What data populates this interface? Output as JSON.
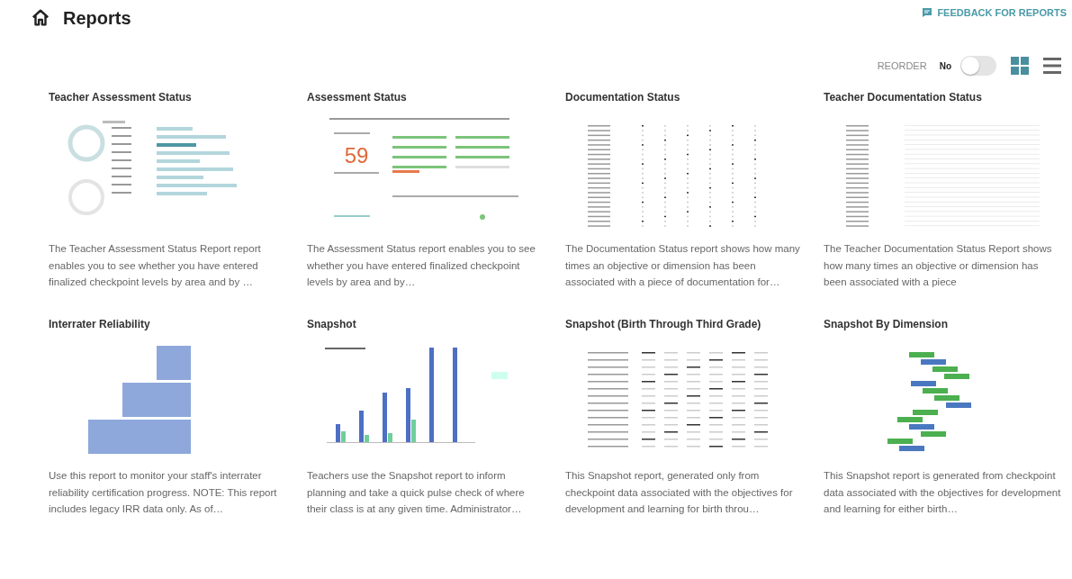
{
  "page": {
    "title": "Reports"
  },
  "feedback_link": "FEEDBACK FOR REPORTS",
  "reorder": {
    "label": "REORDER",
    "value_text": "No",
    "on": false
  },
  "view_modes": [
    {
      "kind": "grid",
      "selected": true
    },
    {
      "kind": "list",
      "selected": false
    }
  ],
  "reports": [
    {
      "title": "Teacher Assessment Status",
      "kind": "donut-bars",
      "description": "The Teacher Assessment Status Report report enables you to see whether you have entered finalized checkpoint levels by area and by …"
    },
    {
      "title": "Assessment Status",
      "kind": "assessment",
      "big_number": "59",
      "description": "The Assessment Status report enables you to see whether you have entered finalized checkpoint levels by area and by…"
    },
    {
      "title": "Documentation Status",
      "kind": "table",
      "description": "The Documentation Status report shows how many times an objective or dimension has been associated with a piece of documentation for…"
    },
    {
      "title": "Teacher Documentation Status",
      "kind": "table-sparse",
      "description": "The Teacher Documentation Status Report shows how many times an objective or dimension has been associated with a piece"
    },
    {
      "title": "Interrater Reliability",
      "kind": "squares",
      "description": "Use this report to monitor your staff's interrater reliability certification progress. NOTE: This report includes legacy IRR data only. As of…"
    },
    {
      "title": "Snapshot",
      "kind": "bar-chart",
      "description": "Teachers use the Snapshot report to inform planning and take a quick pulse check of where their class is at any given time. Administrator…"
    },
    {
      "title": "Snapshot (Birth Through Third Grade)",
      "kind": "table-dense",
      "description": "This Snapshot report, generated only from checkpoint data associated with the objectives for development and learning for birth throu…"
    },
    {
      "title": "Snapshot By Dimension",
      "kind": "tree",
      "description": "This Snapshot report is generated from checkpoint data associated with the objectives for development and learning for either birth…"
    }
  ]
}
